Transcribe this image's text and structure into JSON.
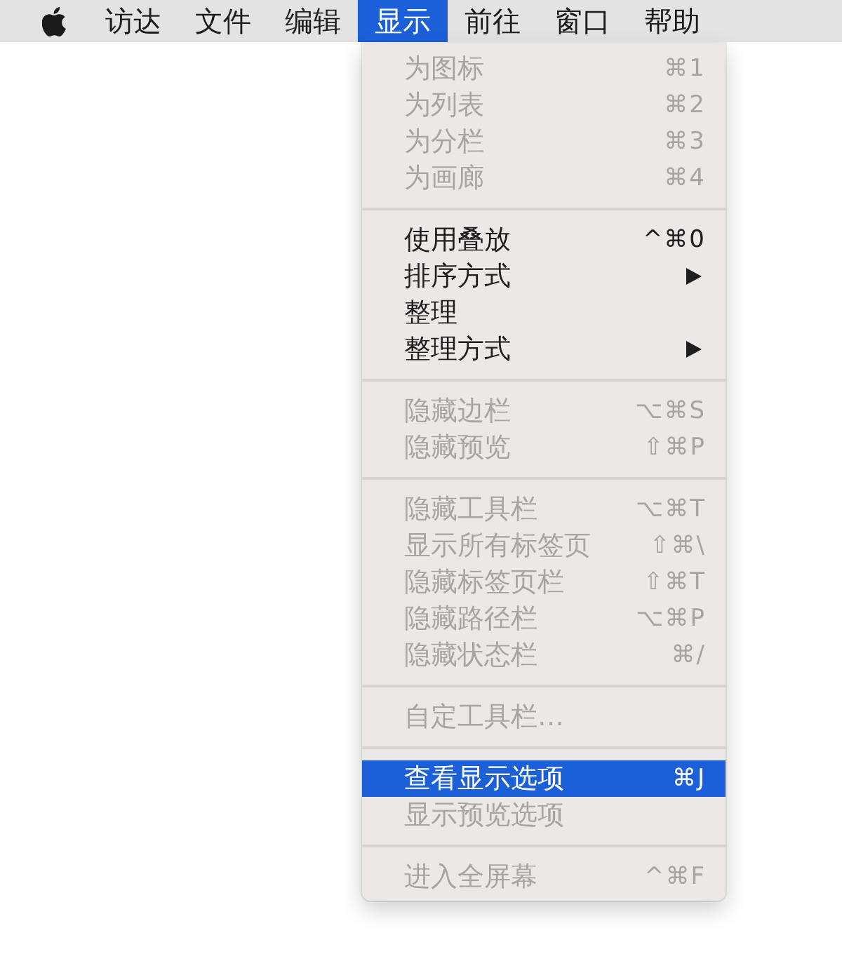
{
  "menu_bar": {
    "items": [
      {
        "label": "访达",
        "selected": false
      },
      {
        "label": "文件",
        "selected": false
      },
      {
        "label": "编辑",
        "selected": false
      },
      {
        "label": "显示",
        "selected": true
      },
      {
        "label": "前往",
        "selected": false
      },
      {
        "label": "窗口",
        "selected": false
      },
      {
        "label": "帮助",
        "selected": false
      }
    ]
  },
  "menu": {
    "sections": [
      {
        "items": [
          {
            "kind": "command",
            "label": "为图标",
            "shortcut": "⌘1",
            "disabled": true,
            "selected": false
          },
          {
            "kind": "command",
            "label": "为列表",
            "shortcut": "⌘2",
            "disabled": true,
            "selected": false
          },
          {
            "kind": "command",
            "label": "为分栏",
            "shortcut": "⌘3",
            "disabled": true,
            "selected": false
          },
          {
            "kind": "command",
            "label": "为画廊",
            "shortcut": "⌘4",
            "disabled": true,
            "selected": false
          }
        ]
      },
      {
        "items": [
          {
            "kind": "command",
            "label": "使用叠放",
            "shortcut": "^⌘0",
            "disabled": false,
            "selected": false
          },
          {
            "kind": "submenu",
            "label": "排序方式",
            "disabled": false,
            "selected": false
          },
          {
            "kind": "command",
            "label": "整理",
            "disabled": false,
            "selected": false
          },
          {
            "kind": "submenu",
            "label": "整理方式",
            "disabled": false,
            "selected": false
          }
        ]
      },
      {
        "items": [
          {
            "kind": "command",
            "label": "隐藏边栏",
            "shortcut": "⌥⌘S",
            "disabled": true,
            "selected": false
          },
          {
            "kind": "command",
            "label": "隐藏预览",
            "shortcut": "⇧⌘P",
            "disabled": true,
            "selected": false
          }
        ]
      },
      {
        "items": [
          {
            "kind": "command",
            "label": "隐藏工具栏",
            "shortcut": "⌥⌘T",
            "disabled": true,
            "selected": false
          },
          {
            "kind": "command",
            "label": "显示所有标签页",
            "shortcut": "⇧⌘\\",
            "disabled": true,
            "selected": false
          },
          {
            "kind": "command",
            "label": "隐藏标签页栏",
            "shortcut": "⇧⌘T",
            "disabled": true,
            "selected": false
          },
          {
            "kind": "command",
            "label": "隐藏路径栏",
            "shortcut": "⌥⌘P",
            "disabled": true,
            "selected": false
          },
          {
            "kind": "command",
            "label": "隐藏状态栏",
            "shortcut": "⌘/",
            "disabled": true,
            "selected": false
          }
        ]
      },
      {
        "items": [
          {
            "kind": "command",
            "label": "自定工具栏…",
            "disabled": true,
            "selected": false
          }
        ]
      },
      {
        "items": [
          {
            "kind": "command",
            "label": "查看显示选项",
            "shortcut": "⌘J",
            "disabled": false,
            "selected": true
          },
          {
            "kind": "command",
            "label": "显示预览选项",
            "disabled": true,
            "selected": false
          }
        ]
      },
      {
        "items": [
          {
            "kind": "command",
            "label": "进入全屏幕",
            "shortcut": "^⌘F",
            "disabled": true,
            "selected": false
          }
        ]
      }
    ]
  }
}
